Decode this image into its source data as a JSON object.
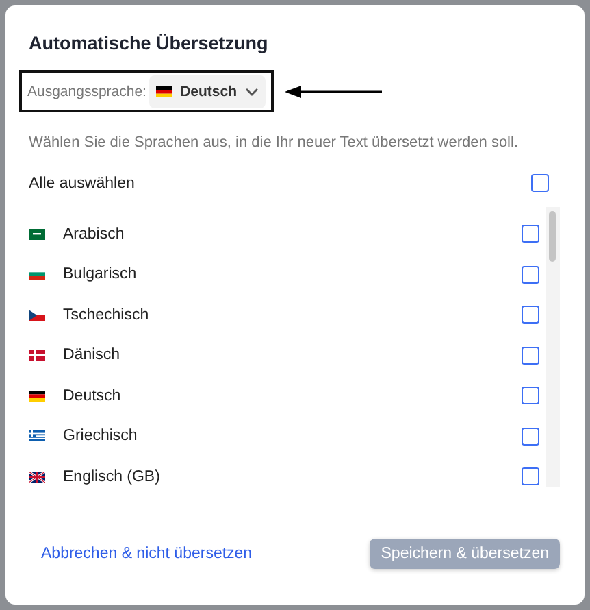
{
  "dialog": {
    "title": "Automatische Übersetzung"
  },
  "source_language": {
    "label": "Ausgangssprache:",
    "value": "Deutsch",
    "kind": "de"
  },
  "description": "Wählen Sie die Sprachen aus, in die Ihr neuer Text übersetzt werden soll.",
  "select_all": {
    "label": "Alle auswählen",
    "checked": false
  },
  "languages": [
    {
      "name": "Arabisch",
      "kind": "sa",
      "checked": false
    },
    {
      "name": "Bulgarisch",
      "kind": "bg",
      "checked": false
    },
    {
      "name": "Tschechisch",
      "kind": "cz",
      "checked": false
    },
    {
      "name": "Dänisch",
      "kind": "dk",
      "checked": false
    },
    {
      "name": "Deutsch",
      "kind": "de",
      "checked": false
    },
    {
      "name": "Griechisch",
      "kind": "gr",
      "checked": false
    },
    {
      "name": "Englisch (GB)",
      "kind": "gb",
      "checked": false
    }
  ],
  "footer": {
    "cancel": "Abbrechen & nicht übersetzen",
    "save": {
      "label": "Speichern & übersetzen",
      "disabled": true
    }
  }
}
